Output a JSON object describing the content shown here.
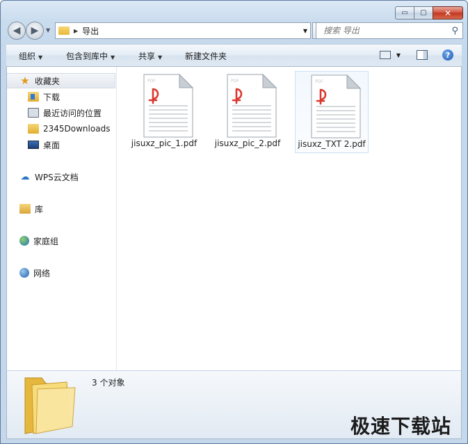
{
  "window": {
    "caption": {
      "minimize": "▭",
      "maximize": "▢",
      "close": "✕"
    }
  },
  "navigation": {
    "back_icon": "back-arrow-icon",
    "forward_icon": "forward-arrow-icon",
    "breadcrumb": [
      "导出"
    ],
    "search_placeholder": "搜索 导出"
  },
  "toolbar": {
    "organize": "组织",
    "include_in_library": "包含到库中",
    "share": "共享",
    "new_folder": "新建文件夹"
  },
  "sidebar": {
    "favorites": {
      "label": "收藏夹",
      "items": [
        {
          "label": "下载",
          "icon": "download-folder-icon"
        },
        {
          "label": "最近访问的位置",
          "icon": "recent-places-icon"
        },
        {
          "label": "2345Downloads",
          "icon": "folder-icon"
        },
        {
          "label": "桌面",
          "icon": "desktop-icon"
        }
      ]
    },
    "wps_cloud": "WPS云文档",
    "libraries": "库",
    "homegroup": "家庭组",
    "network": "网络"
  },
  "files": [
    {
      "name": "jisuxz_pic_1.pdf",
      "type_badge": "PDF",
      "selected": false
    },
    {
      "name": "jisuxz_pic_2.pdf",
      "type_badge": "PDF",
      "selected": false
    },
    {
      "name": "jisuxz_TXT 2.pdf",
      "type_badge": "PDF",
      "selected": true
    }
  ],
  "details": {
    "count_text": "3 个对象"
  },
  "watermark": "极速下载站",
  "colors": {
    "pdf_red": "#d9382f",
    "selection": "#cddff2"
  }
}
